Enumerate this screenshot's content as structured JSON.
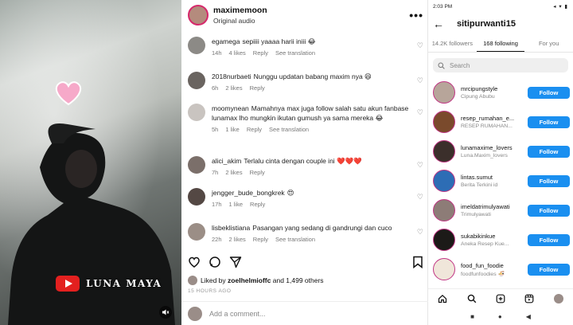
{
  "video": {
    "overlay_label": "LUNA MAYA"
  },
  "post": {
    "username": "maximemoon",
    "audio": "Original audio",
    "more_icon": "more-icon",
    "liked_by_prefix": "Liked by",
    "liked_by_user": "zoelhelmioffc",
    "liked_by_suffix": "and 1,499 others",
    "time": "15 HOURS AGO",
    "add_comment_placeholder": "Add a comment..."
  },
  "comments": [
    {
      "user": "egamega",
      "text": "sepiiii yaaaa harii iniii 😂",
      "time": "14h",
      "likes": "4 likes",
      "reply": "Reply",
      "see": "See translation"
    },
    {
      "user": "2018nurbaeti",
      "text": "Nunggu updatan babang maxim nya 😆",
      "time": "6h",
      "likes": "2 likes",
      "reply": "Reply",
      "see": ""
    },
    {
      "user": "moomynean",
      "text": "Mamahnya max juga follow salah satu akun fanbase lunamax lho mungkin ikutan gumush ya sama mereka 😂",
      "time": "5h",
      "likes": "1 like",
      "reply": "Reply",
      "see": "See translation"
    },
    {
      "user": "alici_akim",
      "text": "Terlalu cinta dengan couple ini ❤️❤️❤️",
      "time": "7h",
      "likes": "2 likes",
      "reply": "Reply",
      "see": ""
    },
    {
      "user": "jengger_bude_bongkrek",
      "text": "😍",
      "time": "17h",
      "likes": "1 like",
      "reply": "Reply",
      "see": ""
    },
    {
      "user": "lisbeklistiana",
      "text": "Pasangan yang sedang di gandrungi dan cuco",
      "time": "22h",
      "likes": "2 likes",
      "reply": "Reply",
      "see": "See translation"
    }
  ],
  "following": {
    "status_time": "2:03 PM",
    "status_icons": "◂ ▾ ▮",
    "title": "sitipurwanti15",
    "tabs": [
      "14.2K followers",
      "168 following",
      "For you"
    ],
    "search_placeholder": "Search",
    "follow_label": "Follow",
    "items": [
      {
        "name": "mrcipungstyle",
        "sub": "Cipung Abubu"
      },
      {
        "name": "resep_rumahan_e...",
        "sub": "RESEP RUMAHAN..."
      },
      {
        "name": "lunamaxime_lovers",
        "sub": "Luna.Maxim_lovers"
      },
      {
        "name": "lintas.sumut",
        "sub": "Berita Terkini id"
      },
      {
        "name": "imeldatrimulyawati",
        "sub": "Trimulyawati"
      },
      {
        "name": "sukabikinkue",
        "sub": "Aneka Resep Kue..."
      },
      {
        "name": "food_fun_foodie",
        "sub": "foodfunfoodies 🍜"
      }
    ],
    "sysnav": [
      "■",
      "●",
      "◀"
    ]
  },
  "colors": {
    "follow_blue": "#1a8ff0",
    "story_ring": "#c13584",
    "youtube_red": "#e3201f"
  }
}
